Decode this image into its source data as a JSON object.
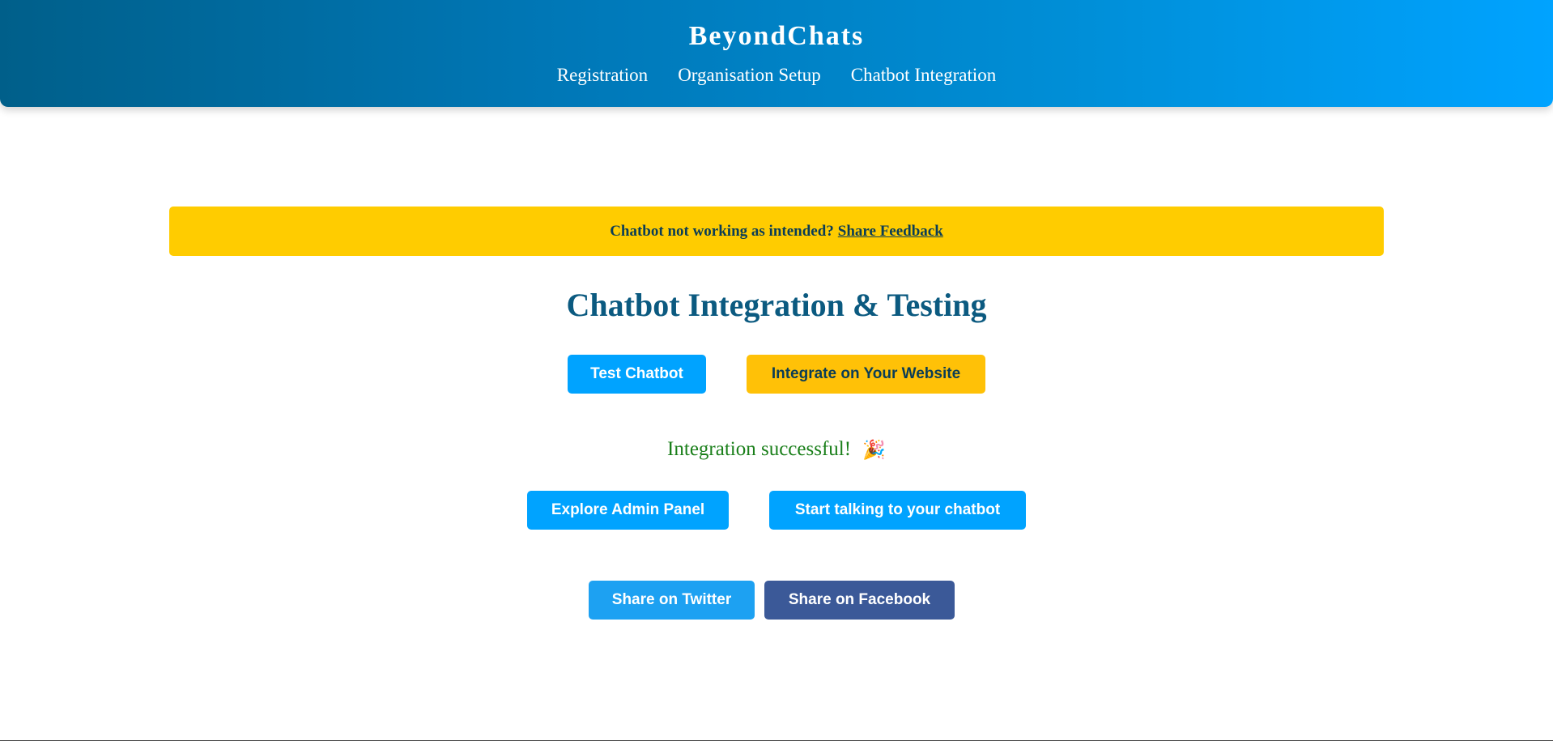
{
  "header": {
    "brand": "BeyondChats",
    "nav": [
      "Registration",
      "Organisation Setup",
      "Chatbot Integration"
    ]
  },
  "banner": {
    "text": "Chatbot not working as intended?",
    "link": "Share Feedback"
  },
  "main": {
    "title": "Chatbot Integration & Testing",
    "test_button": "Test Chatbot",
    "integrate_button": "Integrate on Your Website",
    "success_message": "Integration successful!",
    "success_icon": "party-popper-icon",
    "explore_button": "Explore Admin Panel",
    "start_button": "Start talking to your chatbot",
    "share_twitter": "Share on Twitter",
    "share_facebook": "Share on Facebook"
  },
  "colors": {
    "header_gradient_start": "#005f8a",
    "header_gradient_end": "#00a3ff",
    "banner": "#ffcc00",
    "primary_button": "#00a3ff",
    "integrate_button": "#ffc107",
    "title": "#0b5a80",
    "success": "#1a7f1a",
    "twitter": "#1da1f2",
    "facebook": "#3b5998"
  }
}
